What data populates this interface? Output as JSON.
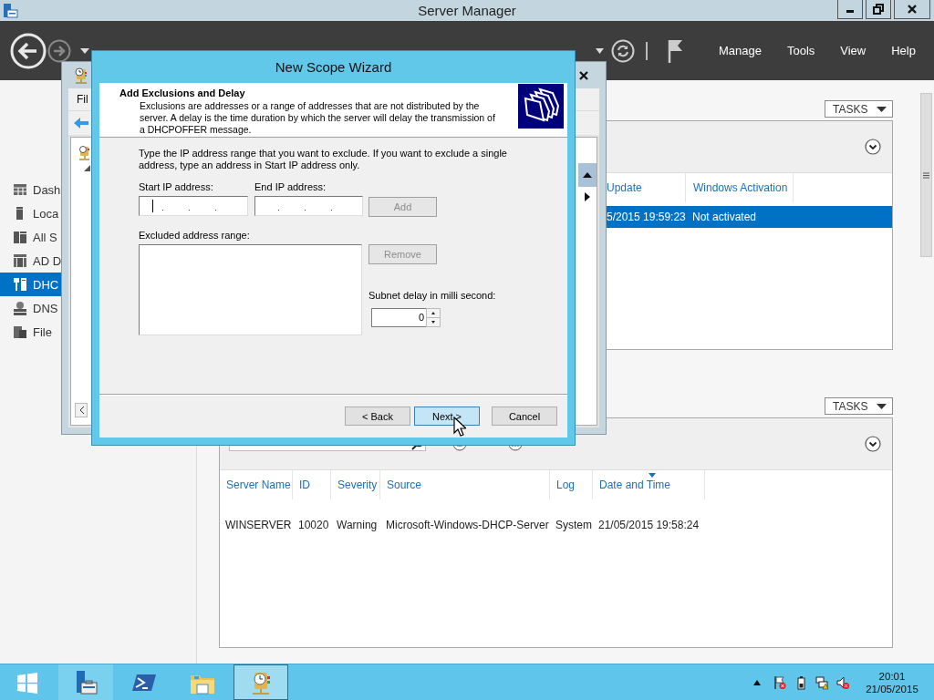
{
  "app_window": {
    "title": "Server Manager",
    "menu": [
      {
        "label": "Manage"
      },
      {
        "label": "Tools"
      },
      {
        "label": "View"
      },
      {
        "label": "Help"
      }
    ]
  },
  "sidebar": {
    "items": [
      {
        "kind": "dashboard",
        "label": "Dash",
        "selected": false
      },
      {
        "kind": "local-server",
        "label": "Loca",
        "selected": false
      },
      {
        "kind": "all-servers",
        "label": "All S",
        "selected": false
      },
      {
        "kind": "directory",
        "label": "AD D",
        "selected": false
      },
      {
        "kind": "dhcp",
        "label": "DHC",
        "selected": true
      },
      {
        "kind": "dns",
        "label": "DNS",
        "selected": false
      },
      {
        "kind": "file",
        "label": "File",
        "selected": false
      }
    ]
  },
  "servers_panel": {
    "tasks_button": "TASKS",
    "columns": [
      {
        "label": "Update",
        "sorted": false
      },
      {
        "label": "Windows Activation",
        "sorted": false
      }
    ],
    "rows": [
      {
        "cells": [
          "5/2015 19:59:23",
          "Not activated"
        ],
        "selected": true
      }
    ]
  },
  "events_panel": {
    "tasks_button": "TASKS",
    "columns": [
      {
        "label": "Server Name",
        "sorted": false
      },
      {
        "label": "ID",
        "sorted": false
      },
      {
        "label": "Severity",
        "sorted": false
      },
      {
        "label": "Source",
        "sorted": false
      },
      {
        "label": "Log",
        "sorted": false
      },
      {
        "label": "Date and Time",
        "sorted": true
      }
    ],
    "rows": [
      {
        "cells": [
          "WINSERVER",
          "10020",
          "Warning",
          "Microsoft-Windows-DHCP-Server",
          "System",
          "21/05/2015 19:58:24"
        ],
        "selected": false
      }
    ]
  },
  "console_window": {
    "menu": [
      "Fil"
    ]
  },
  "wizard": {
    "title": "New Scope Wizard",
    "heading": "Add Exclusions and Delay",
    "description": "Exclusions are addresses or a range of addresses that are not distributed by the server. A delay is the time duration by which the server will delay the transmission of a DHCPOFFER message.",
    "instruction": "Type the IP address range that you want to exclude. If you want to exclude a single address, type an address in Start IP address only.",
    "start_ip": {
      "label": "Start IP address:",
      "focused": true
    },
    "end_ip": {
      "label": "End IP address:",
      "focused": false
    },
    "add_button": {
      "label": "Add",
      "disabled": true
    },
    "excluded_label": "Excluded address range:",
    "remove_button": {
      "label": "Remove",
      "disabled": true
    },
    "delay": {
      "label": "Subnet delay in milli second:",
      "value": "0"
    },
    "buttons": [
      {
        "label": "< Back",
        "default": false
      },
      {
        "label": "Next >",
        "default": true
      },
      {
        "label": "Cancel",
        "default": false
      }
    ]
  },
  "taskbar": {
    "items": [
      {
        "kind": "start",
        "running": false,
        "selected": false
      },
      {
        "kind": "server-manager",
        "running": true,
        "selected": false
      },
      {
        "kind": "powershell",
        "running": false,
        "selected": false
      },
      {
        "kind": "explorer",
        "running": false,
        "selected": false
      },
      {
        "kind": "dhcp",
        "running": true,
        "selected": true
      }
    ],
    "clock": {
      "time": "20:01",
      "date": "21/05/2015"
    }
  }
}
